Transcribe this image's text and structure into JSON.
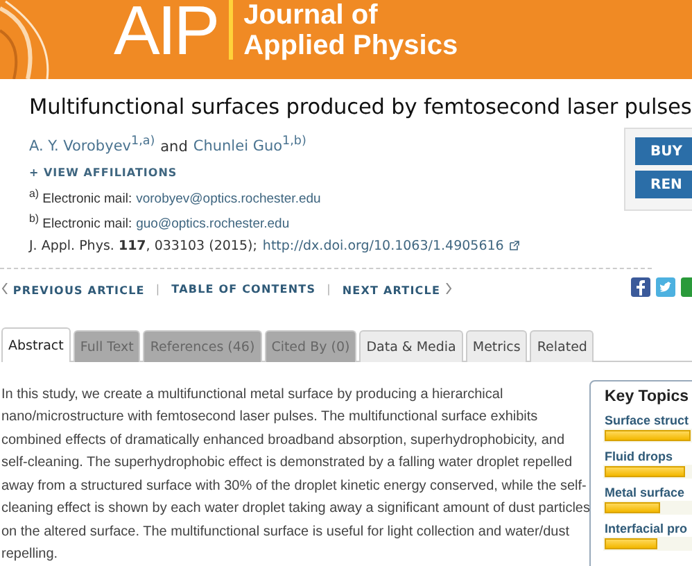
{
  "banner": {
    "logo": "AIP",
    "journal_line_1": "Journal of",
    "journal_line_2": "Applied Physics"
  },
  "title": "Multifunctional surfaces produced by femtosecond laser pulses",
  "authors": [
    {
      "name": "A. Y. Vorobyev",
      "sup": "1,a)"
    },
    {
      "name": "Chunlei Guo",
      "sup": "1,b)"
    }
  ],
  "authors_joiner": "and",
  "view_affiliations": "+ VIEW AFFILIATIONS",
  "emails": [
    {
      "mark": "a)",
      "label": "Electronic mail:",
      "address": "vorobyev@optics.rochester.edu"
    },
    {
      "mark": "b)",
      "label": "Electronic mail:",
      "address": "guo@optics.rochester.edu"
    }
  ],
  "citation": {
    "text": "J. Appl. Phys. **117**, 033103 (2015);",
    "doi": "http://dx.doi.org/10.1063/1.4905616"
  },
  "purchase_buttons": [
    "BUY",
    "REN"
  ],
  "article_nav": {
    "previous": "PREVIOUS ARTICLE",
    "separator_1": "|",
    "contents": "TABLE OF CONTENTS",
    "separator_2": "|",
    "next": "NEXT ARTICLE"
  },
  "tabs": [
    {
      "label": "Abstract",
      "selected": true,
      "locked": false
    },
    {
      "label": "Full Text",
      "selected": false,
      "locked": true
    },
    {
      "label": "References (46)",
      "selected": false,
      "locked": true
    },
    {
      "label": "Cited By (0)",
      "selected": false,
      "locked": true
    },
    {
      "label": "Data & Media",
      "selected": false,
      "locked": false
    },
    {
      "label": "Metrics",
      "selected": false,
      "locked": false
    },
    {
      "label": "Related",
      "selected": false,
      "locked": false
    }
  ],
  "abstract": "In this study, we create a multifunctional metal surface by producing a hierarchical nano/microstructure with femtosecond laser pulses. The multifunctional surface exhibits combined effects of dramatically enhanced broadband absorption, superhydrophobicity, and self-cleaning. The superhydrophobic effect is demonstrated by a falling water droplet repelled away from a structured surface with 30% of the droplet kinetic energy conserved, while the self-cleaning effect is shown by each water droplet taking away a significant amount of dust particles on the altered surface. The multifunctional surface is useful for light collection and water/dust repelling.",
  "key_topics": {
    "title": "Key Topics",
    "items": [
      {
        "label": "Surface struct",
        "level": 1.0
      },
      {
        "label": "Fluid drops",
        "level": 0.93
      },
      {
        "label": "Metal surface",
        "level": 0.65
      },
      {
        "label": "Interfacial pro",
        "level": 0.62
      }
    ]
  }
}
